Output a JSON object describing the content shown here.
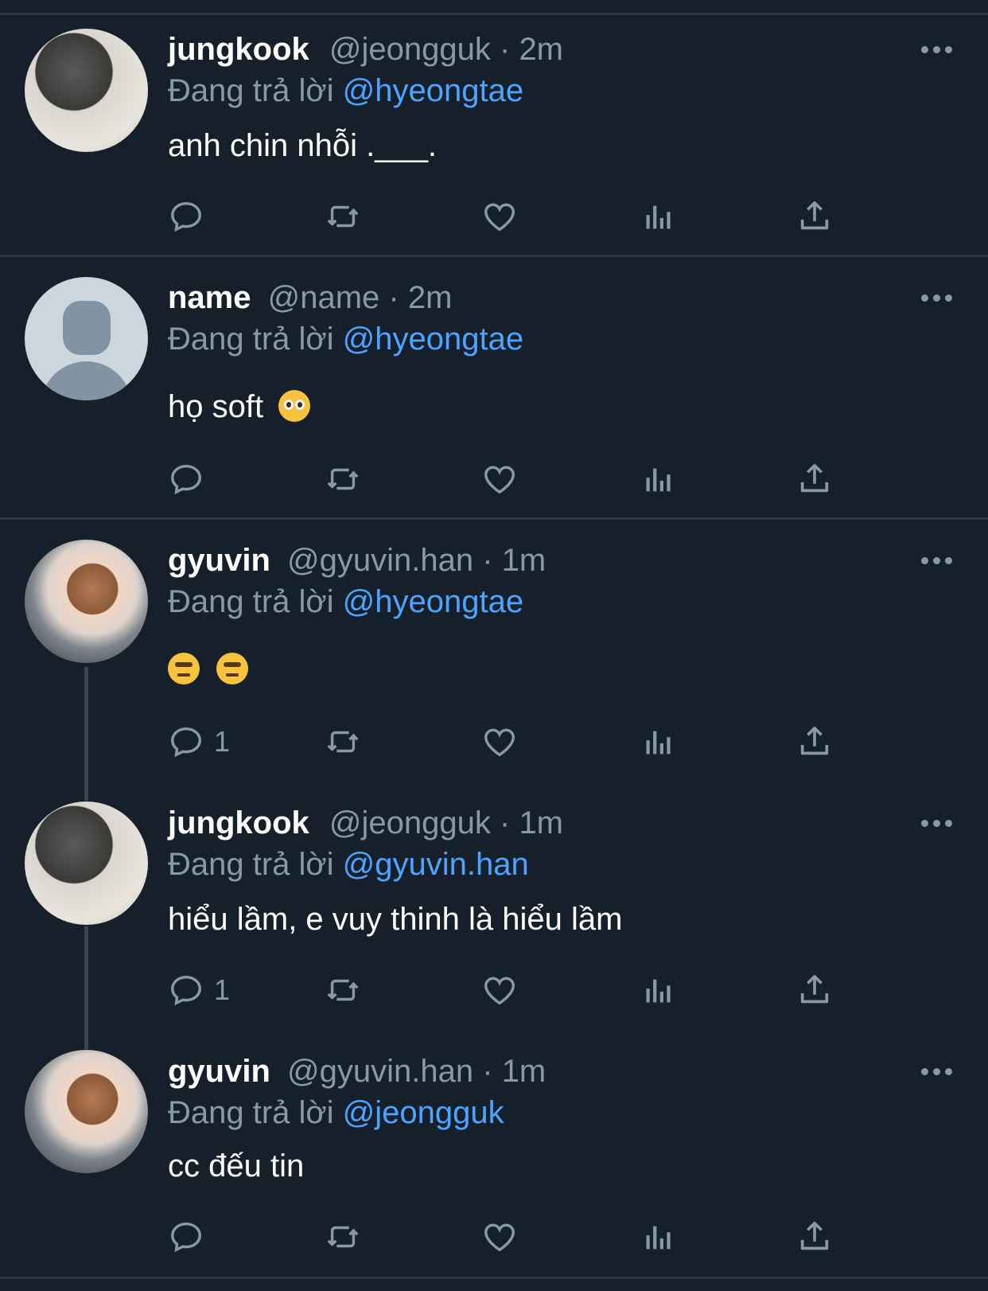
{
  "tweets": [
    {
      "name": "jungkook",
      "handle": "@jeongguk",
      "time": "2m",
      "reply_prefix": "Đang trả lời",
      "reply_to": "@hyeongtae",
      "text": "anh chin nhỗi .___.",
      "emoji": [],
      "avatar": "jungkook-avatar",
      "reply_count": ""
    },
    {
      "name": "name",
      "handle": "@name",
      "time": "2m",
      "reply_prefix": "Đang trả lời",
      "reply_to": "@hyeongtae",
      "text": "họ soft",
      "emoji": [
        "pleading-face"
      ],
      "avatar": "default-avatar",
      "reply_count": ""
    },
    {
      "name": "gyuvin",
      "handle": "@gyuvin.han",
      "time": "1m",
      "reply_prefix": "Đang trả lời",
      "reply_to": "@hyeongtae",
      "text": "",
      "emoji": [
        "raised-eyebrow-face",
        "raised-eyebrow-face"
      ],
      "avatar": "gyuvin-avatar",
      "reply_count": "1"
    },
    {
      "name": "jungkook",
      "handle": "@jeongguk",
      "time": "1m",
      "reply_prefix": "Đang trả lời",
      "reply_to": "@gyuvin.han",
      "text": "hiểu lầm, e vuy thinh là hiểu lầm",
      "emoji": [],
      "avatar": "jungkook-avatar",
      "reply_count": "1"
    },
    {
      "name": "gyuvin",
      "handle": "@gyuvin.han",
      "time": "1m",
      "reply_prefix": "Đang trả lời",
      "reply_to": "@jeongguk",
      "text": "cc đếu tin",
      "emoji": [],
      "avatar": "gyuvin-avatar",
      "reply_count": ""
    }
  ],
  "separator": "·",
  "colors": {
    "background": "#15202b",
    "secondary_text": "#8899a6",
    "mention": "#4da3ff"
  },
  "action_icons": [
    "reply-icon",
    "retweet-icon",
    "like-icon",
    "views-icon",
    "share-icon"
  ]
}
